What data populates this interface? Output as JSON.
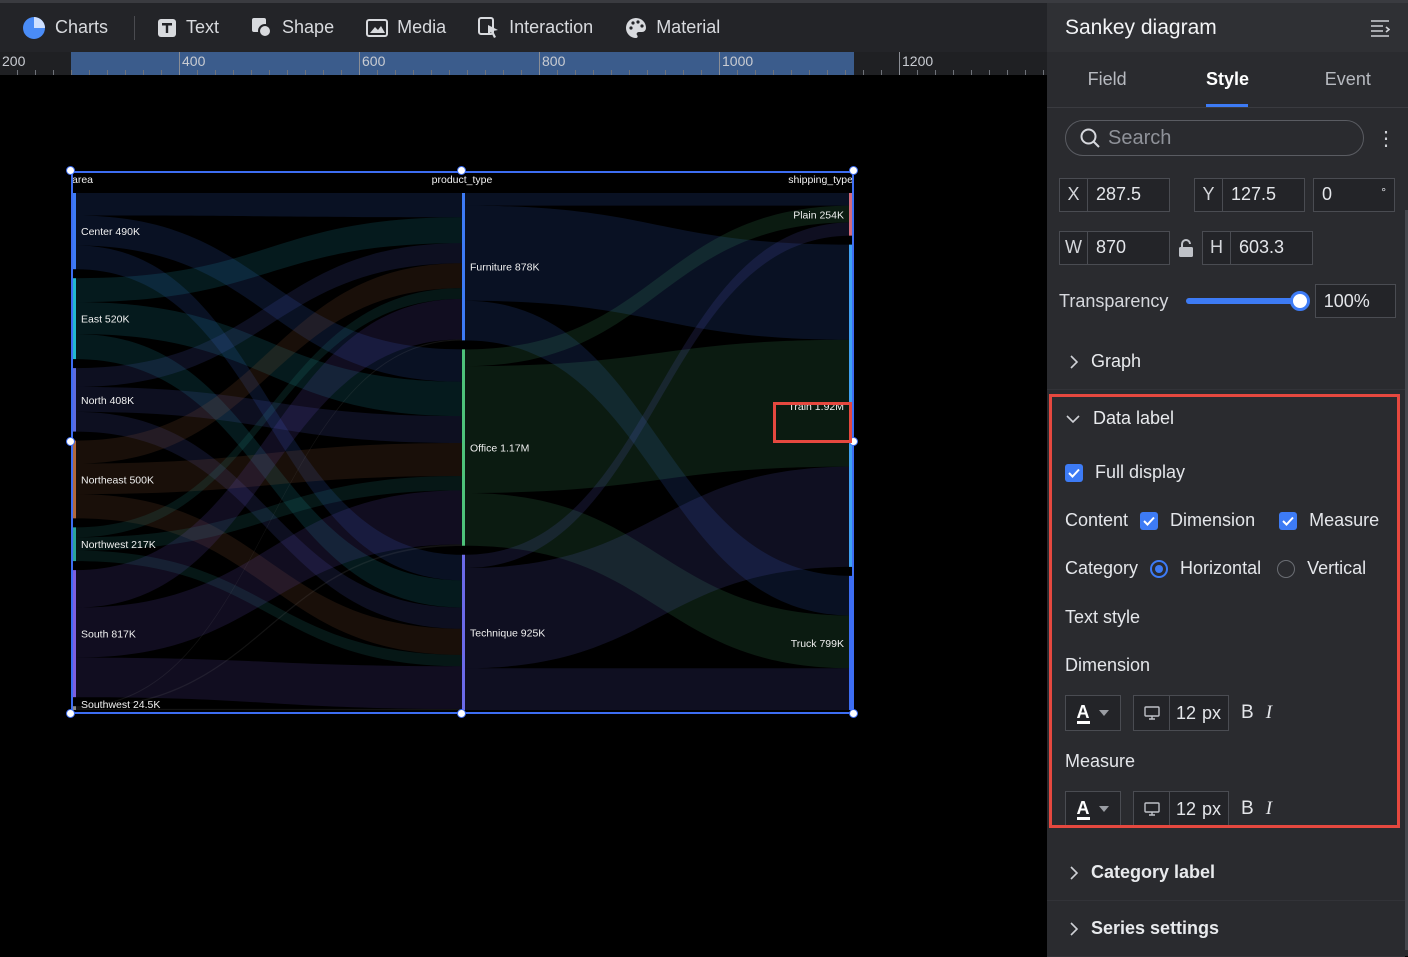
{
  "toolbar": {
    "items": [
      {
        "label": "Charts",
        "icon": "pie-chart-icon"
      },
      {
        "label": "Text",
        "icon": "text-icon"
      },
      {
        "label": "Shape",
        "icon": "shape-icon"
      },
      {
        "label": "Media",
        "icon": "media-icon"
      },
      {
        "label": "Interaction",
        "icon": "interaction-icon"
      },
      {
        "label": "Material",
        "icon": "palette-icon"
      }
    ]
  },
  "ruler": {
    "labels": [
      "200",
      "400",
      "600",
      "800",
      "1000",
      "1200"
    ]
  },
  "chart_data": {
    "type": "sankey",
    "columns": [
      "area",
      "product_type",
      "shipping_type"
    ],
    "nodes": [
      {
        "name": "Center",
        "value": 490000,
        "value_label": "490K",
        "column": 0,
        "color": "#3d7bf5"
      },
      {
        "name": "East",
        "value": 520000,
        "value_label": "520K",
        "column": 0,
        "color": "#22b8cf"
      },
      {
        "name": "North",
        "value": 408000,
        "value_label": "408K",
        "column": 0,
        "color": "#5b6be0"
      },
      {
        "name": "Northeast",
        "value": 500000,
        "value_label": "500K",
        "column": 0,
        "color": "#b0683d"
      },
      {
        "name": "Northwest",
        "value": 217000,
        "value_label": "217K",
        "column": 0,
        "color": "#2aa39a"
      },
      {
        "name": "South",
        "value": 817000,
        "value_label": "817K",
        "column": 0,
        "color": "#7b5fe0"
      },
      {
        "name": "Southwest",
        "value": 24500,
        "value_label": "24.5K",
        "column": 0,
        "color": "#8a8a8a"
      },
      {
        "name": "Furniture",
        "value": 878000,
        "value_label": "878K",
        "column": 1,
        "color": "#3d7bf5"
      },
      {
        "name": "Office",
        "value": 1170000,
        "value_label": "1.17M",
        "column": 1,
        "color": "#4ec27a"
      },
      {
        "name": "Technique",
        "value": 925000,
        "value_label": "925K",
        "column": 1,
        "color": "#6b6ae8"
      },
      {
        "name": "Plain",
        "value": 254000,
        "value_label": "254K",
        "column": 2,
        "color": "#d46a7a"
      },
      {
        "name": "Train",
        "value": 1920000,
        "value_label": "1.92M",
        "column": 2,
        "color": "#3fa0f0"
      },
      {
        "name": "Truck",
        "value": 799000,
        "value_label": "799K",
        "column": 2,
        "color": "#3d6df2"
      }
    ]
  },
  "panel": {
    "title": "Sankey diagram",
    "tabs": [
      "Field",
      "Style",
      "Event"
    ],
    "active_tab": "Style",
    "search_placeholder": "Search",
    "x_label": "X",
    "x_value": "287.5",
    "y_label": "Y",
    "y_value": "127.5",
    "rotation_value": "0",
    "rotation_unit": "°",
    "w_label": "W",
    "w_value": "870",
    "h_label": "H",
    "h_value": "603.3",
    "transparency_label": "Transparency",
    "transparency_value": "100%",
    "transparency_fraction": 1.0,
    "sections": {
      "graph": "Graph",
      "data_label": "Data label",
      "category_label": "Category label",
      "series_settings": "Series settings"
    },
    "data_label": {
      "full_display": "Full display",
      "content_label": "Content",
      "dimension": "Dimension",
      "measure": "Measure",
      "category_label": "Category",
      "horizontal": "Horizontal",
      "vertical": "Vertical",
      "text_style": "Text style",
      "dimension_heading": "Dimension",
      "measure_heading": "Measure",
      "font_size": "12",
      "font_unit": "px",
      "bold": "B",
      "italic": "I",
      "font_color_glyph": "A"
    }
  }
}
